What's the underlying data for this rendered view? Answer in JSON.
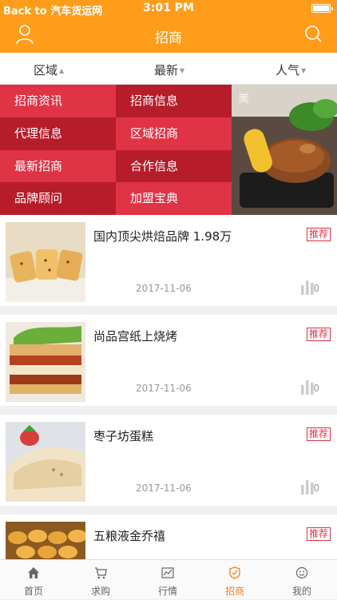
{
  "status_bar": {
    "back": "Back to 汽车货运网",
    "time": "3:01 PM"
  },
  "header": {
    "title": "招商"
  },
  "filters": [
    {
      "label": "区域"
    },
    {
      "label": "最新"
    },
    {
      "label": "人气"
    }
  ],
  "menu": [
    {
      "label": "招商资讯"
    },
    {
      "label": "招商信息"
    },
    {
      "label": "代理信息"
    },
    {
      "label": "区域招商"
    },
    {
      "label": "最新招商"
    },
    {
      "label": "合作信息"
    },
    {
      "label": "品牌顾问"
    },
    {
      "label": "加盟宝典"
    }
  ],
  "items": [
    {
      "title": "国内顶尖烘焙品牌 1.98万",
      "date": "2017-11-06",
      "tag": "推荐",
      "views": "0"
    },
    {
      "title": "尚品宫纸上烧烤",
      "date": "2017-11-06",
      "tag": "推荐",
      "views": "0"
    },
    {
      "title": "枣子坊蛋糕",
      "date": "2017-11-06",
      "tag": "推荐",
      "views": "0"
    },
    {
      "title": "五粮液金乔禧",
      "date": "",
      "tag": "推荐",
      "views": ""
    }
  ],
  "tabs": [
    {
      "label": "首页"
    },
    {
      "label": "求购"
    },
    {
      "label": "行情"
    },
    {
      "label": "招商"
    },
    {
      "label": "我的"
    }
  ],
  "colors": {
    "brand": "#ff9c1a",
    "menu_light": "#e03346",
    "menu_dark": "#b71c2a",
    "active_tab": "#ff7a1a"
  }
}
